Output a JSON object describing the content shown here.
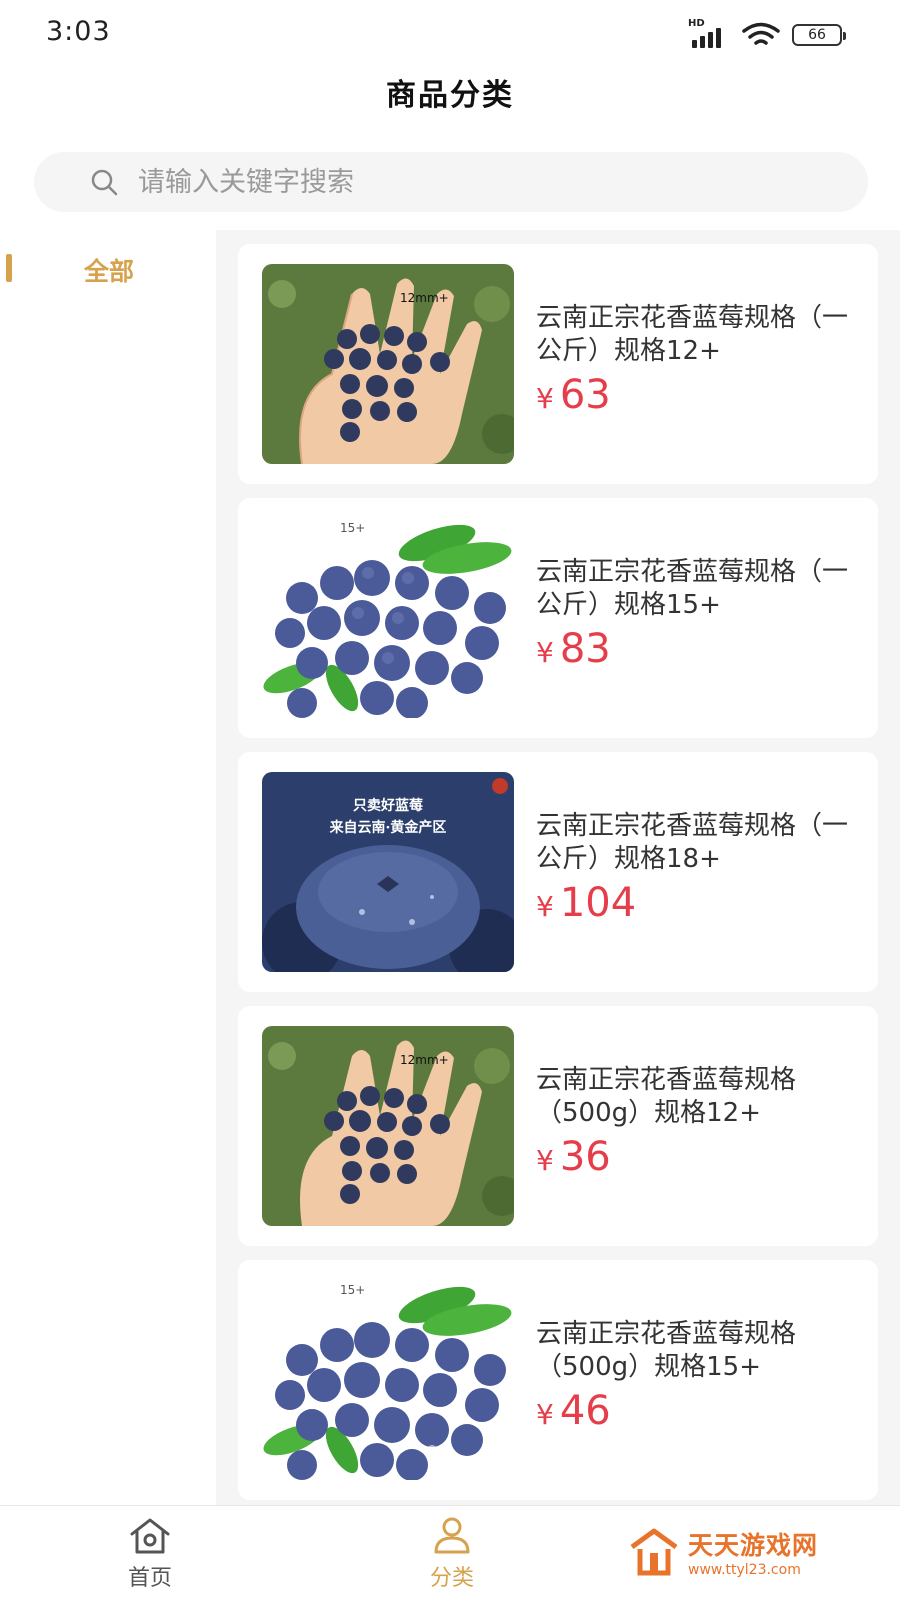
{
  "status_bar": {
    "time": "3:03",
    "network": "HD",
    "battery": "66"
  },
  "header": {
    "title": "商品分类"
  },
  "search": {
    "placeholder": "请输入关键字搜索",
    "value": ""
  },
  "sidebar": {
    "items": [
      {
        "label": "全部",
        "selected": true
      }
    ]
  },
  "products": [
    {
      "name": "云南正宗花香蓝莓规格（一公斤）规格12+",
      "currency": "¥",
      "price": "63",
      "image_label": "12mm+",
      "image": "hand-blueberries"
    },
    {
      "name": "云南正宗花香蓝莓规格（一公斤）规格15+",
      "currency": "¥",
      "price": "83",
      "image_label": "15+",
      "image": "blueberries-leaves"
    },
    {
      "name": "云南正宗花香蓝莓规格（一公斤）规格18+",
      "currency": "¥",
      "price": "104",
      "image_label_1": "只卖好蓝莓",
      "image_label_2": "来自云南·黄金产区",
      "image": "blueberry-closeup"
    },
    {
      "name": "云南正宗花香蓝莓规格（500g）规格12+",
      "currency": "¥",
      "price": "36",
      "image_label": "12mm+",
      "image": "hand-blueberries"
    },
    {
      "name": "云南正宗花香蓝莓规格（500g）规格15+",
      "currency": "¥",
      "price": "46",
      "image_label": "15+",
      "image": "blueberries-leaves"
    }
  ],
  "bottom_nav": [
    {
      "label": "首页",
      "icon": "home-icon",
      "active": false
    },
    {
      "label": "分类",
      "icon": "user-icon",
      "active": true
    }
  ],
  "watermark": {
    "name": "天天游戏网",
    "url": "www.ttyl23.com"
  },
  "colors": {
    "accent": "#d6a24e",
    "price": "#e53e4a",
    "list_bg": "#f5f5f5"
  }
}
